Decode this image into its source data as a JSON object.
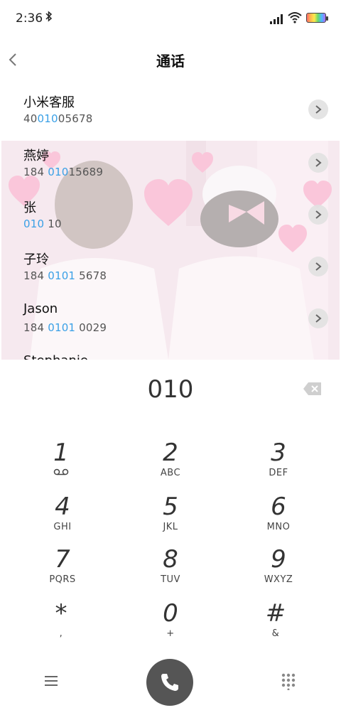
{
  "status": {
    "time": "2:36",
    "bluetooth_icon": "bluetooth-icon"
  },
  "header": {
    "title": "通话"
  },
  "contacts": [
    {
      "name": "小米客服",
      "num_pre": "40",
      "num_hl": "010",
      "num_post": "05678"
    },
    {
      "name": "燕婷",
      "num_pre": "184 ",
      "num_hl": "010",
      "num_post": "15689"
    },
    {
      "name": "张",
      "num_pre": "",
      "num_hl": "010",
      "num_post": " 10"
    },
    {
      "name": "子玲",
      "num_pre": "184 ",
      "num_hl": "0101",
      "num_post": " 5678"
    },
    {
      "name": "Jason",
      "num_pre": "184 ",
      "num_hl": "0101",
      "num_post": " 0029"
    },
    {
      "name": "Stephanie",
      "num_pre": "",
      "num_hl": "",
      "num_post": ""
    }
  ],
  "dial": {
    "digits": "010"
  },
  "keys": [
    {
      "d": "1",
      "l": ""
    },
    {
      "d": "2",
      "l": "ABC"
    },
    {
      "d": "3",
      "l": "DEF"
    },
    {
      "d": "4",
      "l": "GHI"
    },
    {
      "d": "5",
      "l": "JKL"
    },
    {
      "d": "6",
      "l": "MNO"
    },
    {
      "d": "7",
      "l": "PQRS"
    },
    {
      "d": "8",
      "l": "TUV"
    },
    {
      "d": "9",
      "l": "WXYZ"
    },
    {
      "d": "*",
      "l": ","
    },
    {
      "d": "0",
      "l": "+"
    },
    {
      "d": "#",
      "l": "&"
    }
  ],
  "colors": {
    "highlight": "#3aa0e6",
    "call_button": "#555555"
  }
}
